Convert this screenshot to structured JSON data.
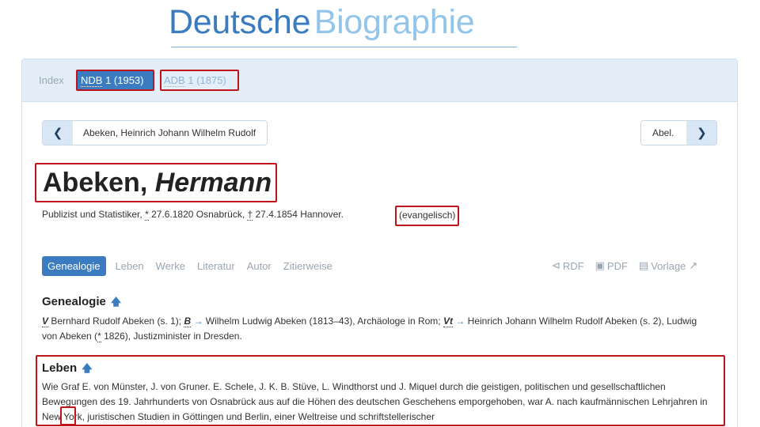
{
  "logo": {
    "word1": "Deutsche",
    "word2": "Biographie"
  },
  "breadcrumb": {
    "index": "Index",
    "ndb_abbr": "NDB",
    "ndb_rest": " 1 (1953)",
    "adb_abbr": "ADB",
    "adb_rest": " 1 (1875)"
  },
  "nav": {
    "prev_label": "Abeken, Heinrich Johann Wilhelm Rudolf",
    "next_label": "Abel."
  },
  "person": {
    "surname": "Abeken, ",
    "given": "Hermann",
    "sub_prefix": "Publizist und Statistiker, ",
    "birth_sym": "*",
    "birth": " 27.6.1820 Osnabrück, ",
    "death_sym": "†",
    "death": " 27.4.1854 Hannover.",
    "confession": "(evangelisch)"
  },
  "tabs": [
    "Genealogie",
    "Leben",
    "Werke",
    "Literatur",
    "Autor",
    "Zitierweise"
  ],
  "tools": {
    "rdf": "RDF",
    "pdf": "PDF",
    "vorlage": "Vorlage"
  },
  "genealogie": {
    "heading": "Genealogie",
    "v": "V",
    "t1": " Bernhard Rudolf Abeken (s. 1); ",
    "b": "B",
    "t2": " Wilhelm Ludwig Abeken (1813–43), Archäologe in Rom; ",
    "vt": "Vt",
    "t3": " Heinrich Johann Wilhelm Rudolf Abeken (s. 2), Ludwig von Abeken (",
    "star": "*",
    "t4": " 1826), Justizminister in Dresden."
  },
  "leben": {
    "heading": "Leben",
    "text": "Wie Graf E. von Münster, J. von Gruner. E. Schele, J. K. B. Stüve, L. Windthorst und J. Miquel durch die geistigen, politischen und gesellschaftlichen Bewegungen des 19. Jahrhunderts von Osnabrück aus auf die Höhen des deutschen Geschehens emporgehoben, war A. nach kaufmännischen Lehrjahren in New York, juristischen Studien in Göttingen und Berlin, einer Weltreise und schriftstellerischer"
  },
  "colors": {
    "accent": "#3a7cbf",
    "highlight": "#c0141b",
    "header_bg": "#e4eef8"
  }
}
